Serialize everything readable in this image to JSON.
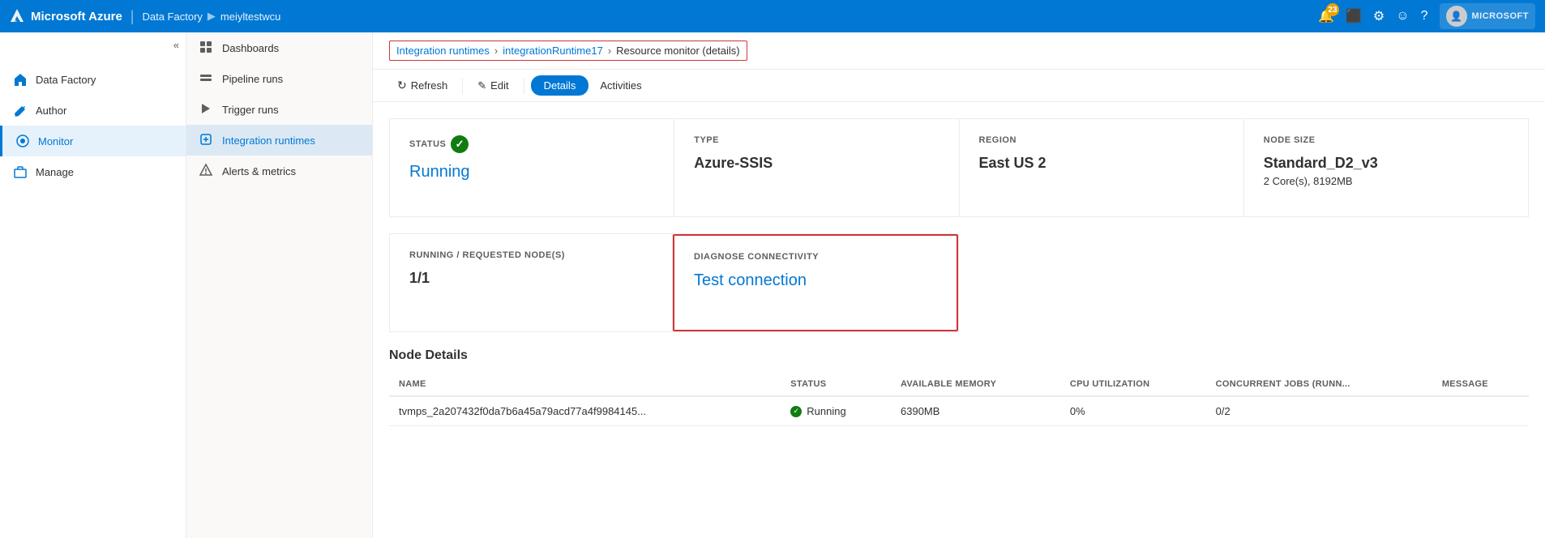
{
  "topbar": {
    "brand": "Microsoft Azure",
    "sep": "|",
    "service": "Data Factory",
    "arrow": "▶",
    "instance": "meiyltestwcu",
    "notification_count": "23",
    "ms_label": "MICROSOFT"
  },
  "leftnav": {
    "items": [
      {
        "id": "data-factory",
        "label": "Data Factory",
        "icon": "home"
      },
      {
        "id": "author",
        "label": "Author",
        "icon": "pencil"
      },
      {
        "id": "monitor",
        "label": "Monitor",
        "icon": "monitor",
        "active": true
      },
      {
        "id": "manage",
        "label": "Manage",
        "icon": "briefcase"
      }
    ],
    "collapse_label": "«"
  },
  "sidemenu": {
    "items": [
      {
        "id": "dashboards",
        "label": "Dashboards",
        "icon": "grid"
      },
      {
        "id": "pipeline-runs",
        "label": "Pipeline runs",
        "icon": "pipeline"
      },
      {
        "id": "trigger-runs",
        "label": "Trigger runs",
        "icon": "trigger"
      },
      {
        "id": "integration-runtimes",
        "label": "Integration runtimes",
        "icon": "runtime",
        "active": true
      },
      {
        "id": "alerts-metrics",
        "label": "Alerts & metrics",
        "icon": "alert"
      }
    ]
  },
  "breadcrumb": {
    "items": [
      {
        "label": "Integration runtimes",
        "link": true
      },
      {
        "label": "integrationRuntime17",
        "link": true
      },
      {
        "label": "Resource monitor (details)",
        "link": false
      }
    ]
  },
  "toolbar": {
    "refresh": "Refresh",
    "edit": "Edit",
    "details": "Details",
    "activities": "Activities"
  },
  "cards": [
    {
      "id": "status",
      "label": "STATUS",
      "value": "Running",
      "type": "link",
      "has_check": true
    },
    {
      "id": "type",
      "label": "TYPE",
      "value": "Azure-SSIS",
      "type": "text"
    },
    {
      "id": "region",
      "label": "REGION",
      "value": "East US 2",
      "type": "text"
    },
    {
      "id": "node-size",
      "label": "NODE SIZE",
      "value": "Standard_D2_v3",
      "sub": "2 Core(s), 8192MB",
      "type": "text"
    }
  ],
  "cards_row2": [
    {
      "id": "running-nodes",
      "label": "RUNNING / REQUESTED NODE(S)",
      "value": "1/1",
      "type": "text"
    },
    {
      "id": "diagnose-connectivity",
      "label": "DIAGNOSE CONNECTIVITY",
      "value": "Test connection",
      "type": "link",
      "highlighted": true
    }
  ],
  "node_details": {
    "title": "Node Details",
    "columns": [
      "NAME",
      "STATUS",
      "AVAILABLE MEMORY",
      "CPU UTILIZATION",
      "CONCURRENT JOBS (RUNN...",
      "MESSAGE"
    ],
    "rows": [
      {
        "name": "tvmps_2a207432f0da7b6a45a79acd77a4f9984145...",
        "status": "Running",
        "available_memory": "6390MB",
        "cpu_utilization": "0%",
        "concurrent_jobs": "0/2",
        "message": ""
      }
    ]
  }
}
